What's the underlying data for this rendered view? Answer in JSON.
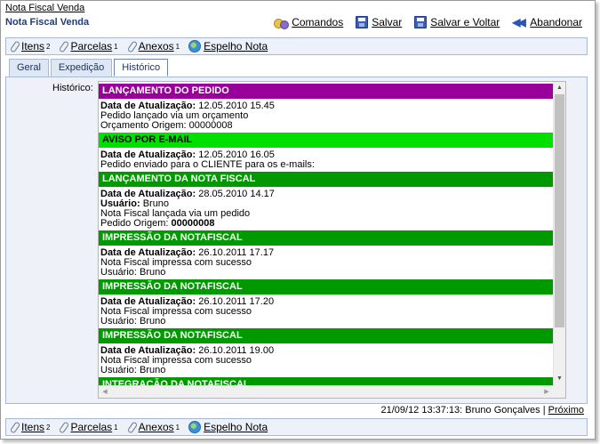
{
  "breadcrumb": "Nota Fiscal Venda",
  "page_title": "Nota Fiscal Venda",
  "actions": [
    {
      "label": "Comandos",
      "icon": "commands-icon"
    },
    {
      "label": "Salvar",
      "icon": "save-icon"
    },
    {
      "label": "Salvar e Voltar",
      "icon": "save-icon"
    },
    {
      "label": "Abandonar",
      "icon": "back-icon"
    }
  ],
  "link_bar": {
    "items": [
      {
        "label": "Itens",
        "count": "2",
        "icon": "paperclip-icon"
      },
      {
        "label": "Parcelas",
        "count": "1",
        "icon": "paperclip-icon"
      },
      {
        "label": "Anexos",
        "count": "1",
        "icon": "paperclip-icon"
      },
      {
        "label": "Espelho Nota",
        "count": "",
        "icon": "globe-icon"
      }
    ]
  },
  "tabs": [
    {
      "label": "Geral",
      "active": false
    },
    {
      "label": "Expedição",
      "active": false
    },
    {
      "label": "Histórico",
      "active": true
    }
  ],
  "history": {
    "field_label": "Histórico:",
    "sections": [
      {
        "title": "LANÇAMENTO DO PEDIDO",
        "color": "#990099",
        "date_label": "Data de Atualização:",
        "date": "12.05.2010 15.45",
        "lines": [
          "Pedido lançado via um orçamento",
          "Orçamento Origem: 00000008"
        ]
      },
      {
        "title": "AVISO POR E-MAIL",
        "color": "#00e000",
        "date_label": "Data de Atualização:",
        "date": "12.05.2010 16.05",
        "lines": [
          "Pedido enviado para o CLIENTE para os e-mails:"
        ]
      },
      {
        "title": "LANÇAMENTO DA NOTA FISCAL",
        "color": "#009900",
        "date_label": "Data de Atualização:",
        "date": "28.05.2010 14.17",
        "user_label": "Usuário:",
        "user": "Bruno",
        "lines": [
          "Nota Fiscal lançada via um pedido"
        ],
        "origin_label": "Pedido Origem:",
        "origin": "00000008"
      },
      {
        "title": "IMPRESSÃO DA NOTAFISCAL",
        "color": "#009900",
        "date_label": "Data de Atualização:",
        "date": "26.10.2011 17.17",
        "lines": [
          "Nota Fiscal impressa com sucesso",
          "Usuário: Bruno"
        ]
      },
      {
        "title": "IMPRESSÃO DA NOTAFISCAL",
        "color": "#009900",
        "date_label": "Data de Atualização:",
        "date": "26.10.2011 17.20",
        "lines": [
          "Nota Fiscal impressa com sucesso",
          "Usuário: Bruno"
        ]
      },
      {
        "title": "IMPRESSÃO DA NOTAFISCAL",
        "color": "#009900",
        "date_label": "Data de Atualização:",
        "date": "26.10.2011 19.00",
        "lines": [
          "Nota Fiscal impressa com sucesso",
          "Usuário: Bruno"
        ]
      },
      {
        "title": "INTEGRAÇÃO DA NOTAFISCAL",
        "color": "#009900"
      }
    ]
  },
  "footer": {
    "status": "21/09/12 13:37:13: Bruno Gonçalves |",
    "next_label": "Próximo"
  }
}
